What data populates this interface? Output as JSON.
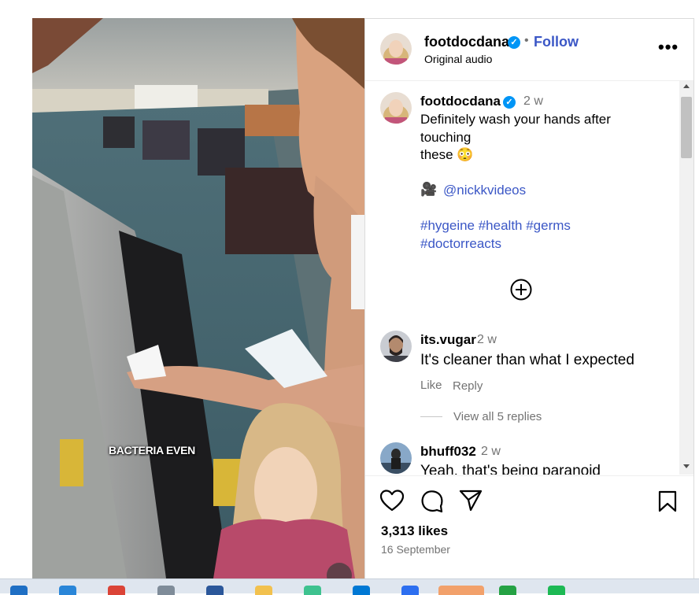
{
  "header": {
    "username": "footdocdana",
    "dot": "•",
    "follow_label": "Follow",
    "audio": "Original audio",
    "more_icon": "more-horizontal-icon"
  },
  "caption": {
    "username": "footdocdana",
    "time": "2 w",
    "line1": "Definitely wash your hands after",
    "line2": "touching",
    "line3": "these 😳",
    "mention_emoji": "🎥",
    "mention": "@nickkvideos",
    "tags_line1": "#hygeine #health #germs",
    "tags_line2": "#doctorreacts"
  },
  "comments": [
    {
      "username": "its.vugar",
      "time": "2 w",
      "text": "It's cleaner than what I expected",
      "like": "Like",
      "reply": "Reply",
      "view_replies": "View all 5 replies"
    },
    {
      "username": "bhuff032",
      "time": "2 w",
      "text": "Yeah, that's being paranoid"
    }
  ],
  "video": {
    "overlay_text": "BACTERIA EVEN"
  },
  "actions": {
    "likes": "3,313 likes",
    "date": "16 September"
  },
  "colors": {
    "link": "#3b57c6",
    "verified": "#0095f6"
  }
}
